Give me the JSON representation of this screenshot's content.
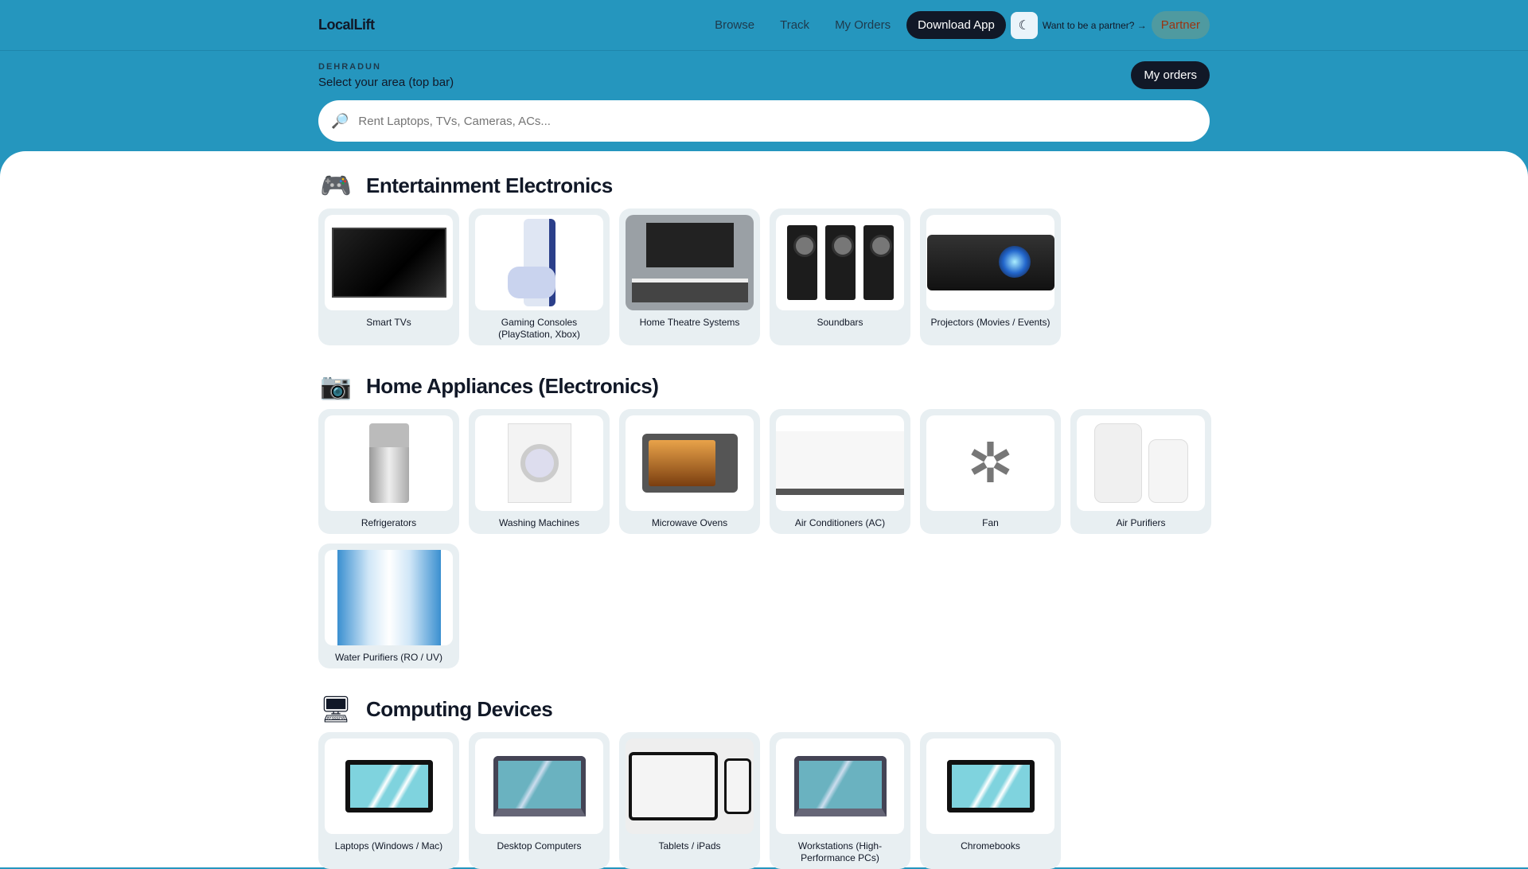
{
  "header": {
    "logo": "LocalLift",
    "nav": [
      "Browse",
      "Track",
      "My Orders"
    ],
    "download": "Download App",
    "partner_prompt": "Want to be a partner? →",
    "partner": "Partner"
  },
  "location": {
    "city": "DEHRADUN",
    "area": "Select your area (top bar)",
    "my_orders": "My orders"
  },
  "search": {
    "placeholder": "Rent Laptops, TVs, Cameras, ACs..."
  },
  "sections": [
    {
      "title": "Entertainment Electronics",
      "items": [
        "Smart TVs",
        "Gaming Consoles (PlayStation, Xbox)",
        "Home Theatre Systems",
        "Soundbars",
        "Projectors (Movies / Events)"
      ]
    },
    {
      "title": "Home Appliances (Electronics)",
      "items": [
        "Refrigerators",
        "Washing Machines",
        "Microwave Ovens",
        "Air Conditioners (AC)",
        "Fan",
        "Air Purifiers",
        "Water Purifiers (RO / UV)"
      ]
    },
    {
      "title": "Computing Devices",
      "items": [
        "Laptops (Windows / Mac)",
        "Desktop Computers",
        "Tablets / iPads",
        "Workstations (High-Performance PCs)",
        "Chromebooks"
      ]
    }
  ]
}
